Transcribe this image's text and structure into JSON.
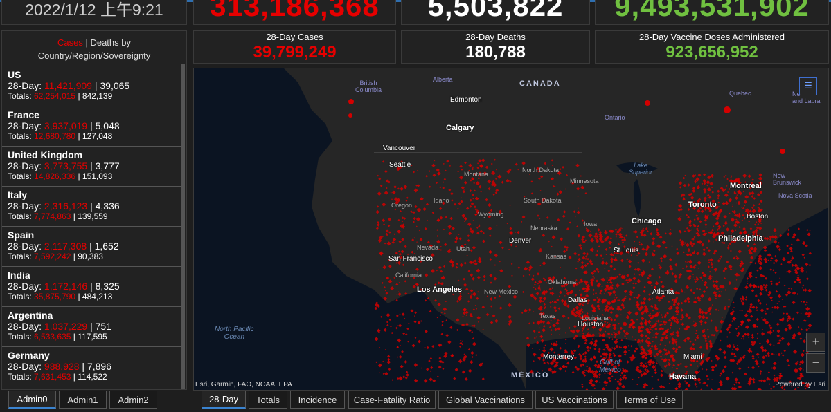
{
  "header": {
    "date": "2022/1/12 上午9:21",
    "global_cases": "313,186,368",
    "global_deaths": "5,503,822",
    "vaccine_doses": "9,493,531,902"
  },
  "stats": [
    {
      "label": "28-Day Cases",
      "value": "39,799,249",
      "color": "#e60000"
    },
    {
      "label": "28-Day Deaths",
      "value": "180,788",
      "color": "#ffffff"
    },
    {
      "label": "28-Day Vaccine Doses Administered",
      "value": "923,656,952",
      "color": "#70c040"
    }
  ],
  "list": {
    "title_cases": "Cases",
    "title_rest": "| Deaths by",
    "subtitle": "Country/Region/Sovereignty",
    "d28_prefix": "28-Day:",
    "tot_prefix": "Totals:",
    "items": [
      {
        "name": "US",
        "cases28": "11,421,909",
        "deaths28": "| 39,065",
        "totcases": "62,254,015",
        "totdeaths": "| 842,139"
      },
      {
        "name": "France",
        "cases28": "3,937,019",
        "deaths28": "| 5,048",
        "totcases": "12,680,780",
        "totdeaths": "| 127,048"
      },
      {
        "name": "United Kingdom",
        "cases28": "3,773,755",
        "deaths28": "| 3,777",
        "totcases": "14,826,336",
        "totdeaths": "| 151,093"
      },
      {
        "name": "Italy",
        "cases28": "2,316,123",
        "deaths28": "| 4,336",
        "totcases": "7,774,863",
        "totdeaths": "| 139,559"
      },
      {
        "name": "Spain",
        "cases28": "2,117,308",
        "deaths28": "| 1,652",
        "totcases": "7,592,242",
        "totdeaths": "| 90,383"
      },
      {
        "name": "India",
        "cases28": "1,172,146",
        "deaths28": "| 8,325",
        "totcases": "35,875,790",
        "totdeaths": "| 484,213"
      },
      {
        "name": "Argentina",
        "cases28": "1,037,229",
        "deaths28": "| 751",
        "totcases": "6,533,635",
        "totdeaths": "| 117,595"
      },
      {
        "name": "Germany",
        "cases28": "988,928",
        "deaths28": "| 7,896",
        "totcases": "7,631,453",
        "totdeaths": "| 114,522"
      }
    ]
  },
  "map": {
    "attribution": "Esri, Garmin, FAO, NOAA, EPA",
    "powered": "Powered by Esri",
    "zoom_in": "+",
    "zoom_out": "−",
    "legend_icon": "list-icon",
    "countries": {
      "canada": "CANADA",
      "mexico": "MÉXICO"
    },
    "oceans": {
      "pacific_1": "North Pacific",
      "pacific_2": "Ocean",
      "gulf_1": "Gulf of",
      "gulf_2": "Mexico"
    },
    "regions": {
      "bc_1": "British",
      "bc_2": "Columbia",
      "alberta": "Alberta",
      "ontario": "Ontario",
      "quebec": "Quebec",
      "ns": "Nova Scotia",
      "nb_1": "New",
      "nb_2": "Brunswick",
      "nf_1": "Ne",
      "nf_2": "and Labra",
      "lake_1": "Lake",
      "lake_2": "Superior",
      "montana": "Montana",
      "nd": "North Dakota",
      "minnesota": "Minnesota",
      "idaho": "Idaho",
      "wyoming": "Wyoming",
      "sd": "South Dakota",
      "oregon": "Oregon",
      "nebraska": "Nebraska",
      "iowa": "Iowa",
      "nevada": "Nevada",
      "utah": "Utah",
      "kansas": "Kansas",
      "california": "California",
      "newmexico": "New Mexico",
      "oklahoma": "Oklahoma",
      "texas": "Texas",
      "louisiana": "Louisiana"
    },
    "cities": {
      "edmonton": "Edmonton",
      "calgary": "Calgary",
      "vancouver": "Vancouver",
      "seattle": "Seattle",
      "montreal": "Montreal",
      "toronto": "Toronto",
      "chicago": "Chicago",
      "boston": "Boston",
      "philadelphia": "Philadelphia",
      "denver": "Denver",
      "sanfrancisco": "San Francisco",
      "losangeles": "Los Angeles",
      "stlouis": "St Louis",
      "dallas": "Dallas",
      "atlanta": "Atlanta",
      "houston": "Houston",
      "miami": "Miami",
      "monterrey": "Monterrey",
      "havana": "Havana"
    },
    "colors": {
      "point": "#d40000",
      "land": "#262626",
      "water": "#0b1422"
    }
  },
  "tabs_left": [
    "Admin0",
    "Admin1",
    "Admin2"
  ],
  "tabs_bottom": [
    "28-Day",
    "Totals",
    "Incidence",
    "Case-Fatality Ratio",
    "Global Vaccinations",
    "US Vaccinations",
    "Terms of Use"
  ]
}
